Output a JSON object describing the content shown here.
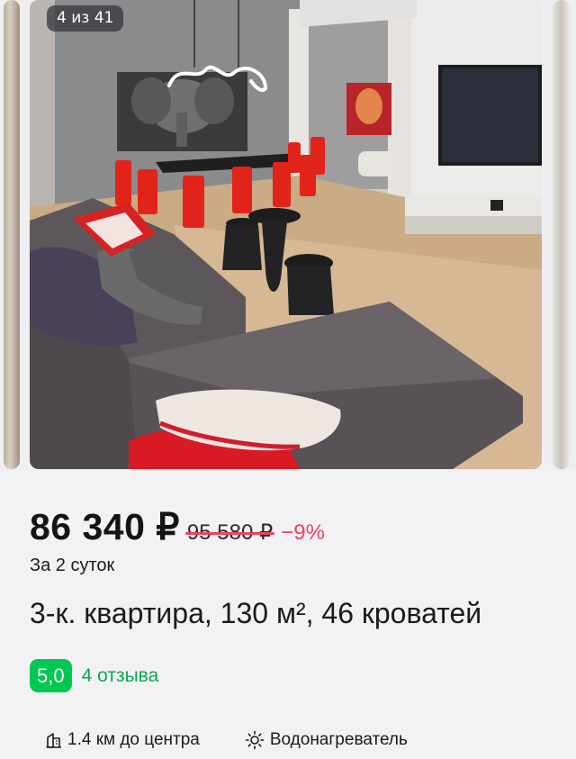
{
  "gallery": {
    "counter": "4 из 41"
  },
  "listing": {
    "price": "86 340 ₽",
    "old_price": "95 580 ₽",
    "discount": "−9%",
    "period": "За 2 суток",
    "title": "3-к. квартира, 130 м², 46 кроватей",
    "rating": "5,0",
    "reviews": "4 отзыва"
  },
  "features": [
    {
      "icon": "building-icon",
      "label": "1.4 км до центра"
    },
    {
      "icon": "sun-icon",
      "label": "Водонагреватель"
    }
  ],
  "colors": {
    "rating_badge": "#00c853",
    "reviews_link": "#0ca650",
    "discount": "#f0405b",
    "card_background": "#f2f2f4"
  }
}
